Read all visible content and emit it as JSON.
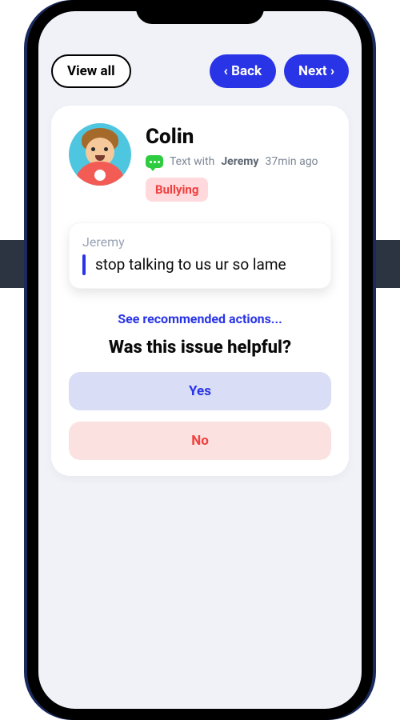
{
  "topbar": {
    "view_all": "View all",
    "back": "Back",
    "next": "Next"
  },
  "profile": {
    "name": "Colin",
    "context_prefix": "Text with",
    "context_name": "Jeremy",
    "context_time": "37min ago",
    "tag": "Bullying"
  },
  "message": {
    "sender": "Jeremy",
    "text": "stop talking to us ur so lame"
  },
  "actions_link": "See recommended actions...",
  "question": "Was this issue helpful?",
  "answers": {
    "yes": "Yes",
    "no": "No"
  }
}
